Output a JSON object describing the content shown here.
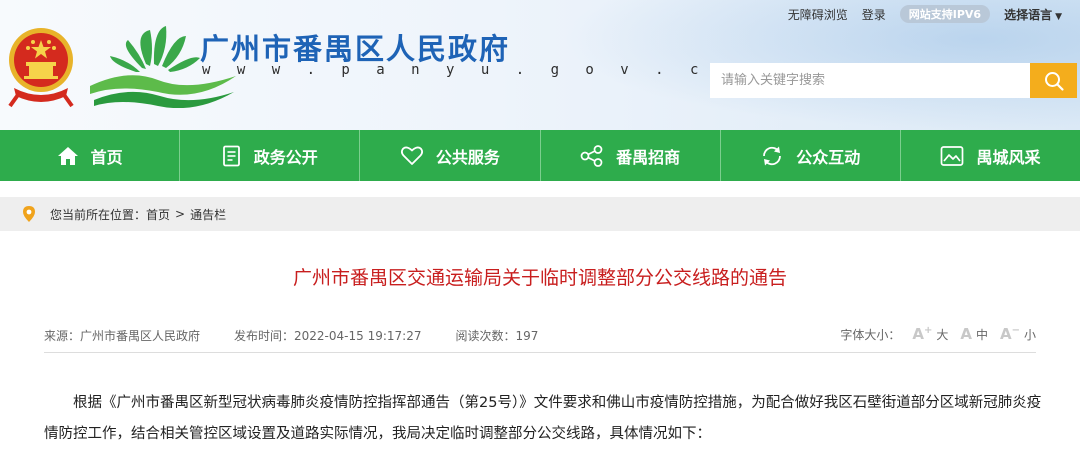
{
  "top_links": {
    "accessible": "无障碍浏览",
    "login": "登录",
    "ipv6": "网站支持IPV6",
    "language": "选择语言"
  },
  "site": {
    "title": "广州市番禺区人民政府",
    "url": "w w w . p a n y u . g o v . c n"
  },
  "search": {
    "placeholder": "请输入关键字搜索"
  },
  "nav": {
    "items": [
      {
        "label": "首页",
        "icon": "home-icon"
      },
      {
        "label": "政务公开",
        "icon": "document-icon"
      },
      {
        "label": "公共服务",
        "icon": "heart-icon"
      },
      {
        "label": "番禺招商",
        "icon": "share-icon"
      },
      {
        "label": "公众互动",
        "icon": "refresh-icon"
      },
      {
        "label": "禺城风采",
        "icon": "picture-icon"
      }
    ]
  },
  "breadcrumb": {
    "prefix": "您当前所在位置：",
    "home": "首页",
    "separator": ">",
    "current": "通告栏"
  },
  "article": {
    "title": "广州市番禺区交通运输局关于临时调整部分公交线路的通告",
    "source": "来源：广州市番禺区人民政府",
    "published": "发布时间：2022-04-15 19:17:27",
    "views": "阅读次数：197",
    "font_size_label": "字体大小：",
    "size_large": "大",
    "size_medium": "中",
    "size_small": "小",
    "body": "根据《广州市番禺区新型冠状病毒肺炎疫情防控指挥部通告（第25号）》文件要求和佛山市疫情防控措施，为配合做好我区石壁街道部分区域新冠肺炎疫情防控工作，结合相关管控区域设置及道路实际情况，我局决定临时调整部分公交线路，具体情况如下："
  },
  "colors": {
    "nav_green": "#2eac4c",
    "title_blue": "#1e63b6",
    "article_red": "#c81e1e",
    "search_orange": "#f4ad1c"
  }
}
